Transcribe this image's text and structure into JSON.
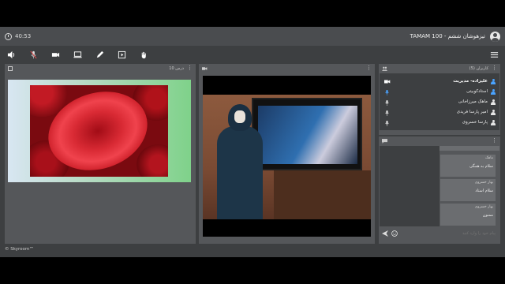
{
  "header": {
    "time": "40:53",
    "room_title": "تیزهوشان ششم - TAMAM 100"
  },
  "toolbar": {
    "tools": [
      "volume-icon",
      "mic-off-icon",
      "camera-icon",
      "screen-share-icon",
      "pen-icon",
      "presentation-icon",
      "raise-hand-icon"
    ],
    "menu": "menu-icon"
  },
  "slides_panel": {
    "title": "درس 10"
  },
  "video_panel": {
    "title": ""
  },
  "users_panel": {
    "title": "کاربران (5)",
    "users": [
      {
        "name": "علیزاده- مدیریت",
        "role": "admin",
        "status_icon": "camera-icon",
        "color": "#4aa3ff"
      },
      {
        "name": "استادکوبیتی",
        "role": "presenter",
        "status_icon": "",
        "color": "#4aa3ff"
      },
      {
        "name": "ماهک میرزاخانی",
        "role": "student",
        "status_icon": "mic-icon",
        "color": "#e6e6e6"
      },
      {
        "name": "امیر پارسا فریدی",
        "role": "student",
        "status_icon": "mic-icon",
        "color": "#e6e6e6"
      },
      {
        "name": "پارسا خسروی",
        "role": "student",
        "status_icon": "mic-icon",
        "color": "#e6e6e6"
      }
    ]
  },
  "chat_panel": {
    "messages": [
      {
        "author": "ماهک",
        "text": "سلام به همگی"
      },
      {
        "author": "بهار خسروی",
        "text": "سلام استاد"
      },
      {
        "author": "بهار خسروی",
        "text": "ممنون"
      }
    ],
    "input_placeholder": "پیام خود را وارد کنید"
  },
  "footer": {
    "brand": "© Skyroom™"
  },
  "colors": {
    "app_bg": "#3d3f41",
    "panel_bg": "#55575a",
    "accent": "#4aa3ff"
  }
}
